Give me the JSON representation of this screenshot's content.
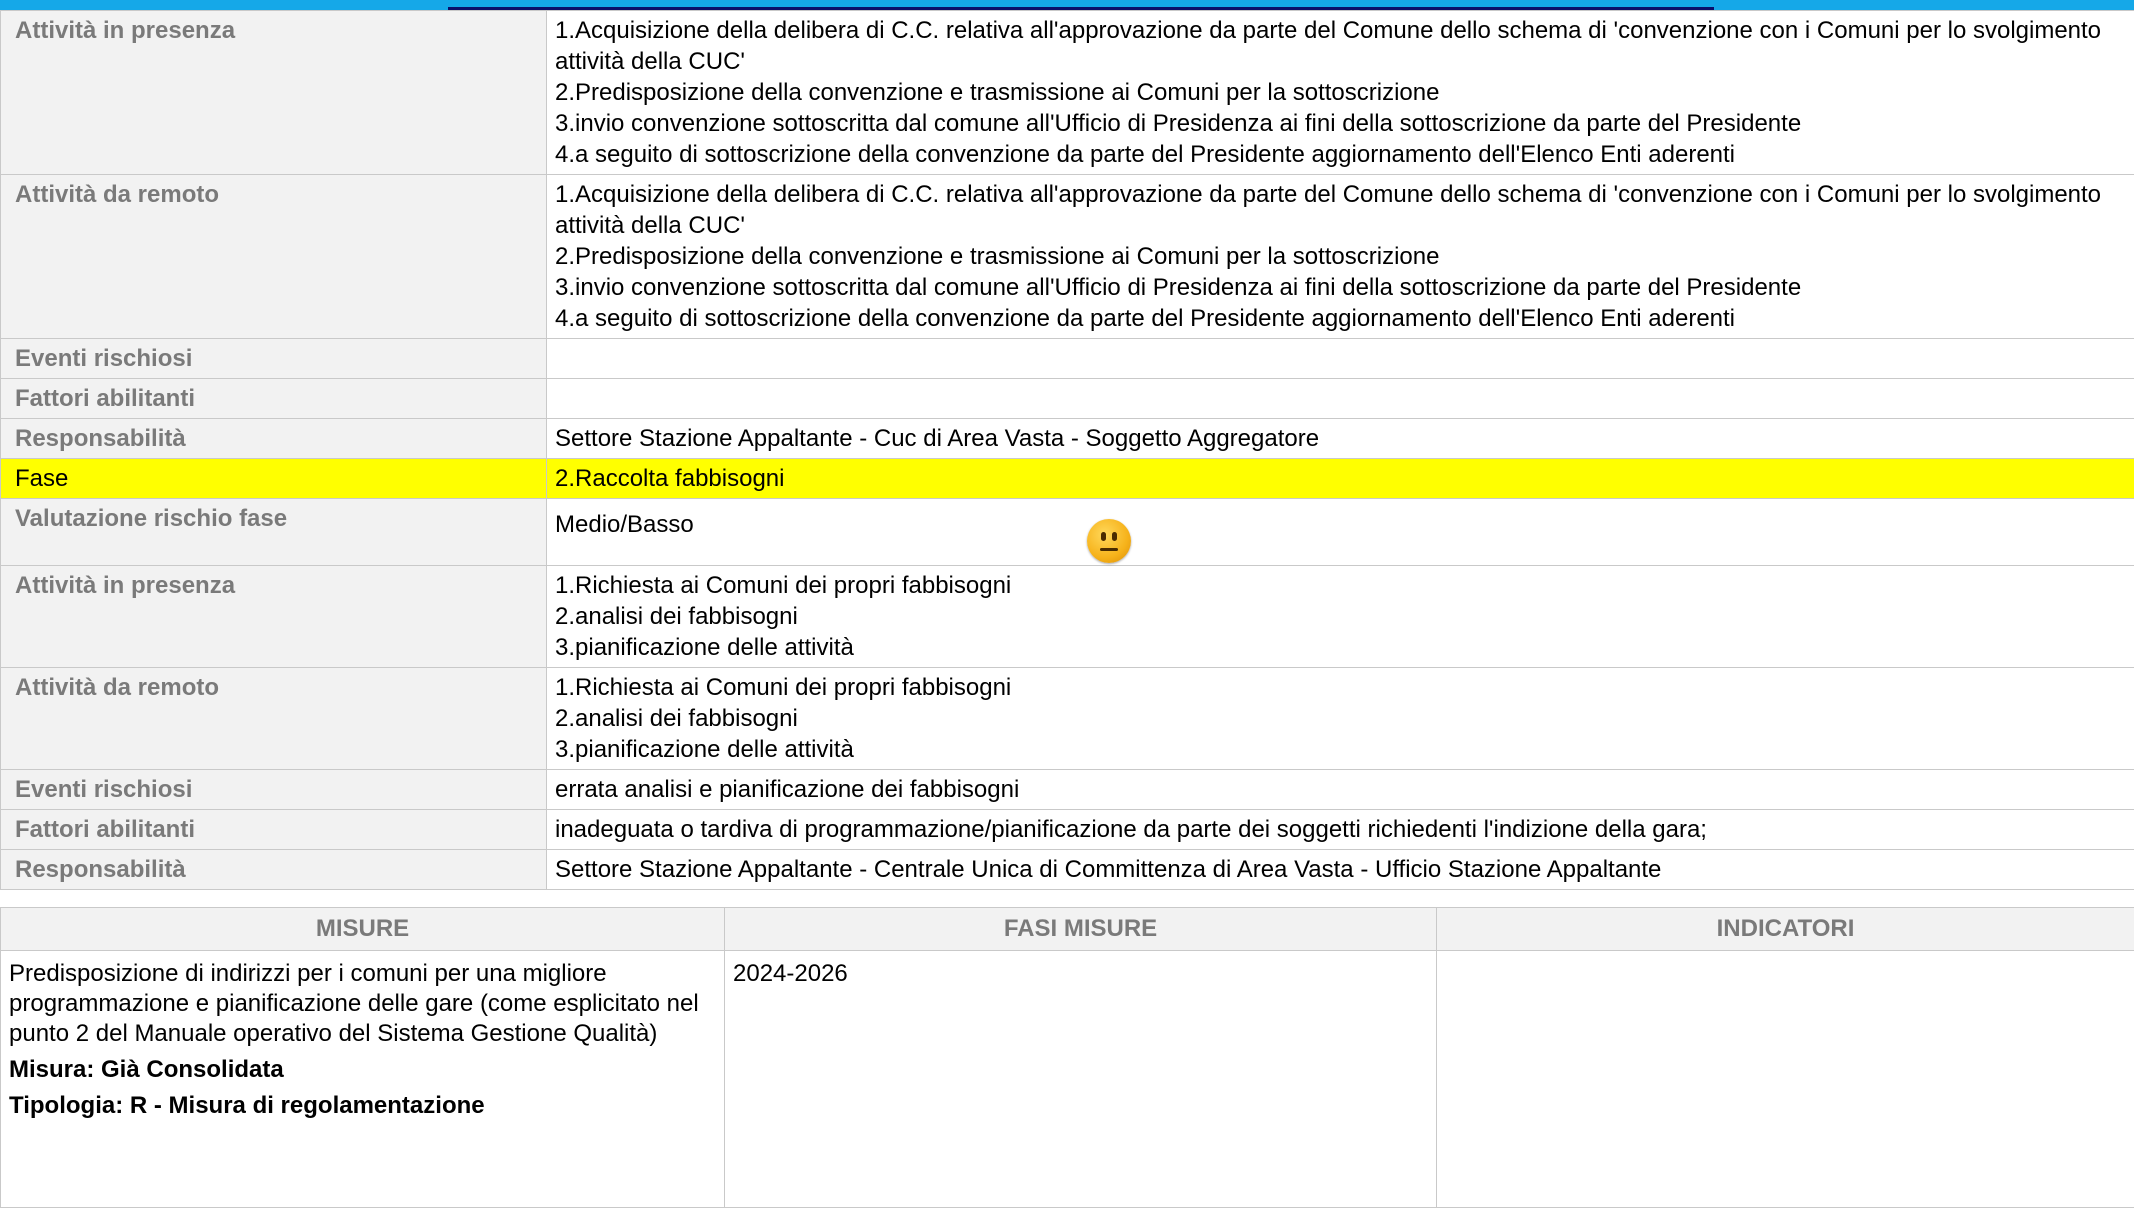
{
  "rows_top": [
    {
      "label": "Attività in presenza",
      "lines": [
        "1.Acquisizione della delibera di C.C. relativa all'approvazione da parte del Comune dello schema di 'convenzione con i Comuni per lo svolgimento attività della CUC'",
        "2.Predisposizione della convenzione e trasmissione ai Comuni per la sottoscrizione",
        "3.invio convenzione sottoscritta dal comune all'Ufficio di Presidenza ai fini della sottoscrizione da parte del Presidente",
        "4.a seguito di sottoscrizione della convenzione da parte del Presidente aggiornamento dell'Elenco Enti aderenti"
      ]
    },
    {
      "label": "Attività da remoto",
      "lines": [
        "1.Acquisizione della delibera di C.C. relativa all'approvazione da parte del Comune dello schema di 'convenzione con i Comuni per lo svolgimento attività della CUC'",
        "2.Predisposizione della convenzione e trasmissione ai Comuni per la sottoscrizione",
        "3.invio convenzione sottoscritta dal comune all'Ufficio di Presidenza ai fini della sottoscrizione da parte del Presidente",
        "4.a seguito di sottoscrizione della convenzione da parte del Presidente aggiornamento dell'Elenco Enti aderenti"
      ]
    },
    {
      "label": "Eventi rischiosi",
      "lines": [
        ""
      ]
    },
    {
      "label": "Fattori abilitanti",
      "lines": [
        ""
      ]
    },
    {
      "label": "Responsabilità",
      "lines": [
        "Settore Stazione Appaltante - Cuc di Area Vasta - Soggetto Aggregatore"
      ]
    }
  ],
  "fase": {
    "label": "Fase",
    "value": "2.Raccolta fabbisogni"
  },
  "valutazione": {
    "label": "Valutazione rischio fase",
    "value": "Medio/Basso",
    "icon": "neutral-face-icon"
  },
  "rows_bottom": [
    {
      "label": "Attività in presenza",
      "lines": [
        "1.Richiesta ai Comuni dei propri fabbisogni",
        "2.analisi dei fabbisogni",
        "3.pianificazione delle attività"
      ]
    },
    {
      "label": "Attività da remoto",
      "lines": [
        "1.Richiesta ai Comuni dei propri fabbisogni",
        "2.analisi dei fabbisogni",
        "3.pianificazione delle attività"
      ]
    },
    {
      "label": "Eventi rischiosi",
      "lines": [
        "errata analisi e pianificazione dei fabbisogni"
      ]
    },
    {
      "label": "Fattori abilitanti",
      "lines": [
        "inadeguata o tardiva  di programmazione/pianificazione da parte dei soggetti richiedenti l'indizione della gara;"
      ]
    },
    {
      "label": "Responsabilità",
      "lines": [
        "Settore Stazione Appaltante - Centrale Unica di Committenza di Area Vasta - Ufficio  Stazione Appaltante"
      ]
    }
  ],
  "misure": {
    "headers": [
      "MISURE",
      "FASI MISURE",
      "INDICATORI"
    ],
    "text": "Predisposizione di indirizzi per i comuni per una migliore programmazione e pianificazione delle gare (come esplicitato nel punto 2 del Manuale operativo del Sistema Gestione Qualità)",
    "misura": "Misura: Già Consolidata",
    "tipologia": "Tipologia: R - Misura di regolamentazione",
    "fasi": "2024-2026",
    "indicatori": ""
  }
}
